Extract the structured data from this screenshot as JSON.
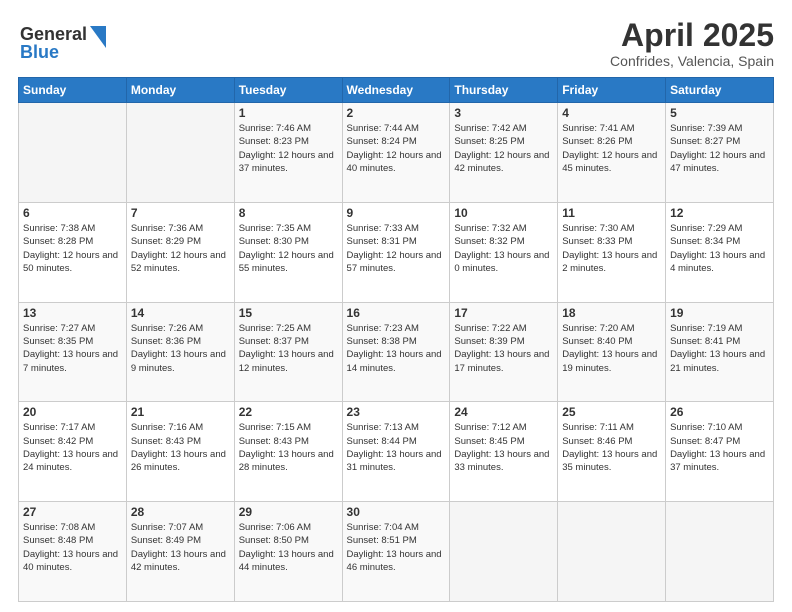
{
  "header": {
    "title": "April 2025",
    "subtitle": "Confrides, Valencia, Spain"
  },
  "columns": [
    "Sunday",
    "Monday",
    "Tuesday",
    "Wednesday",
    "Thursday",
    "Friday",
    "Saturday"
  ],
  "weeks": [
    [
      {
        "day": "",
        "info": ""
      },
      {
        "day": "",
        "info": ""
      },
      {
        "day": "1",
        "info": "Sunrise: 7:46 AM\nSunset: 8:23 PM\nDaylight: 12 hours and 37 minutes."
      },
      {
        "day": "2",
        "info": "Sunrise: 7:44 AM\nSunset: 8:24 PM\nDaylight: 12 hours and 40 minutes."
      },
      {
        "day": "3",
        "info": "Sunrise: 7:42 AM\nSunset: 8:25 PM\nDaylight: 12 hours and 42 minutes."
      },
      {
        "day": "4",
        "info": "Sunrise: 7:41 AM\nSunset: 8:26 PM\nDaylight: 12 hours and 45 minutes."
      },
      {
        "day": "5",
        "info": "Sunrise: 7:39 AM\nSunset: 8:27 PM\nDaylight: 12 hours and 47 minutes."
      }
    ],
    [
      {
        "day": "6",
        "info": "Sunrise: 7:38 AM\nSunset: 8:28 PM\nDaylight: 12 hours and 50 minutes."
      },
      {
        "day": "7",
        "info": "Sunrise: 7:36 AM\nSunset: 8:29 PM\nDaylight: 12 hours and 52 minutes."
      },
      {
        "day": "8",
        "info": "Sunrise: 7:35 AM\nSunset: 8:30 PM\nDaylight: 12 hours and 55 minutes."
      },
      {
        "day": "9",
        "info": "Sunrise: 7:33 AM\nSunset: 8:31 PM\nDaylight: 12 hours and 57 minutes."
      },
      {
        "day": "10",
        "info": "Sunrise: 7:32 AM\nSunset: 8:32 PM\nDaylight: 13 hours and 0 minutes."
      },
      {
        "day": "11",
        "info": "Sunrise: 7:30 AM\nSunset: 8:33 PM\nDaylight: 13 hours and 2 minutes."
      },
      {
        "day": "12",
        "info": "Sunrise: 7:29 AM\nSunset: 8:34 PM\nDaylight: 13 hours and 4 minutes."
      }
    ],
    [
      {
        "day": "13",
        "info": "Sunrise: 7:27 AM\nSunset: 8:35 PM\nDaylight: 13 hours and 7 minutes."
      },
      {
        "day": "14",
        "info": "Sunrise: 7:26 AM\nSunset: 8:36 PM\nDaylight: 13 hours and 9 minutes."
      },
      {
        "day": "15",
        "info": "Sunrise: 7:25 AM\nSunset: 8:37 PM\nDaylight: 13 hours and 12 minutes."
      },
      {
        "day": "16",
        "info": "Sunrise: 7:23 AM\nSunset: 8:38 PM\nDaylight: 13 hours and 14 minutes."
      },
      {
        "day": "17",
        "info": "Sunrise: 7:22 AM\nSunset: 8:39 PM\nDaylight: 13 hours and 17 minutes."
      },
      {
        "day": "18",
        "info": "Sunrise: 7:20 AM\nSunset: 8:40 PM\nDaylight: 13 hours and 19 minutes."
      },
      {
        "day": "19",
        "info": "Sunrise: 7:19 AM\nSunset: 8:41 PM\nDaylight: 13 hours and 21 minutes."
      }
    ],
    [
      {
        "day": "20",
        "info": "Sunrise: 7:17 AM\nSunset: 8:42 PM\nDaylight: 13 hours and 24 minutes."
      },
      {
        "day": "21",
        "info": "Sunrise: 7:16 AM\nSunset: 8:43 PM\nDaylight: 13 hours and 26 minutes."
      },
      {
        "day": "22",
        "info": "Sunrise: 7:15 AM\nSunset: 8:43 PM\nDaylight: 13 hours and 28 minutes."
      },
      {
        "day": "23",
        "info": "Sunrise: 7:13 AM\nSunset: 8:44 PM\nDaylight: 13 hours and 31 minutes."
      },
      {
        "day": "24",
        "info": "Sunrise: 7:12 AM\nSunset: 8:45 PM\nDaylight: 13 hours and 33 minutes."
      },
      {
        "day": "25",
        "info": "Sunrise: 7:11 AM\nSunset: 8:46 PM\nDaylight: 13 hours and 35 minutes."
      },
      {
        "day": "26",
        "info": "Sunrise: 7:10 AM\nSunset: 8:47 PM\nDaylight: 13 hours and 37 minutes."
      }
    ],
    [
      {
        "day": "27",
        "info": "Sunrise: 7:08 AM\nSunset: 8:48 PM\nDaylight: 13 hours and 40 minutes."
      },
      {
        "day": "28",
        "info": "Sunrise: 7:07 AM\nSunset: 8:49 PM\nDaylight: 13 hours and 42 minutes."
      },
      {
        "day": "29",
        "info": "Sunrise: 7:06 AM\nSunset: 8:50 PM\nDaylight: 13 hours and 44 minutes."
      },
      {
        "day": "30",
        "info": "Sunrise: 7:04 AM\nSunset: 8:51 PM\nDaylight: 13 hours and 46 minutes."
      },
      {
        "day": "",
        "info": ""
      },
      {
        "day": "",
        "info": ""
      },
      {
        "day": "",
        "info": ""
      }
    ]
  ]
}
